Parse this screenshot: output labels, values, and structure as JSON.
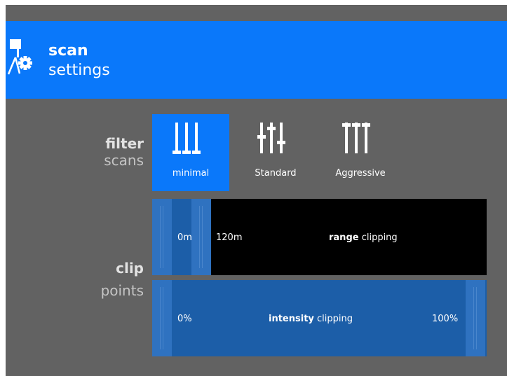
{
  "header": {
    "title_line1": "scan",
    "title_line2": "settings",
    "icon": "scanner-gear-icon",
    "background_color": "#0a78fa"
  },
  "filter": {
    "label_bold": "filter",
    "label_light": "scans",
    "selected": "minimal",
    "options": [
      {
        "label": "minimal",
        "icon": "three-sliders-low-icon"
      },
      {
        "label": "Standard",
        "icon": "three-sliders-mixed-icon"
      },
      {
        "label": "Aggressive",
        "icon": "three-sliders-high-icon"
      }
    ]
  },
  "clip": {
    "label_bold": "clip",
    "label_light": "points",
    "range": {
      "min_label": "0m",
      "max_label": "120m",
      "title_bold": "range",
      "title_rest": " clipping"
    },
    "intensity": {
      "min_label": "0%",
      "max_label": "100%",
      "title_bold": "intensity",
      "title_rest": " clipping"
    }
  },
  "colors": {
    "accent": "#0a78fa",
    "panel_background": "#626262",
    "slider_fill": "#1c5ea8",
    "slider_track": "#000000"
  }
}
